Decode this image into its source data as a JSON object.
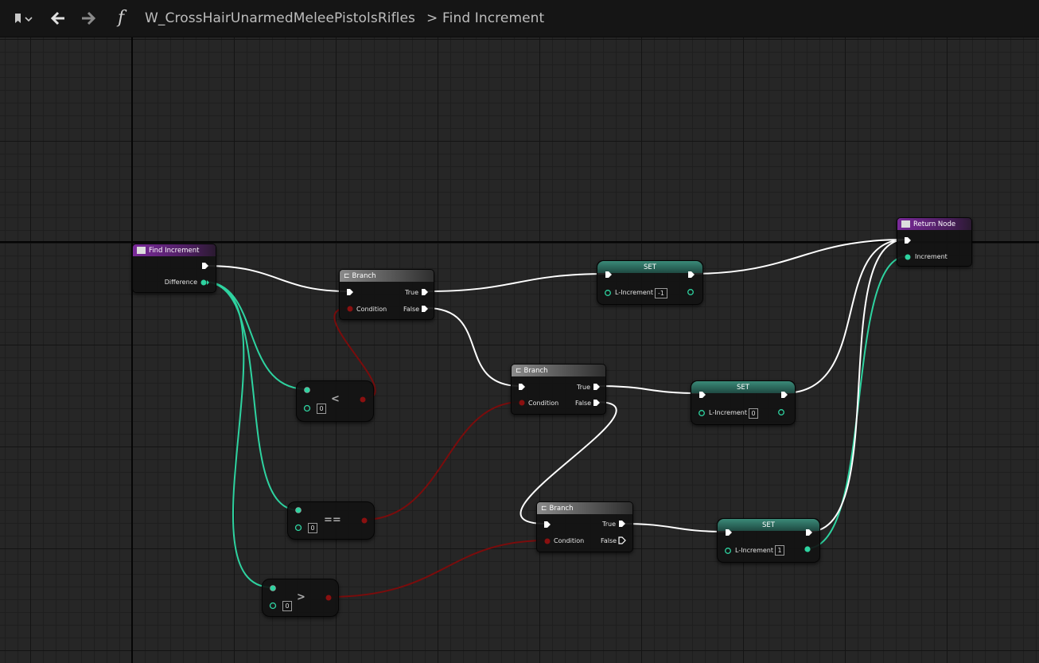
{
  "toolbar": {
    "bookmark_icon": "bookmark-icon",
    "back_icon": "arrow-left-icon",
    "forward_icon": "arrow-right-icon",
    "function_glyph": "f",
    "breadcrumb_root": "W_CrossHairUnarmedMeleePistolsRifles",
    "breadcrumb_separator": ">",
    "breadcrumb_current": "Find Increment"
  },
  "nodes": {
    "entry": {
      "title": "Find Increment",
      "pin_difference": "Difference"
    },
    "branch1": {
      "title": "Branch",
      "pin_condition": "Condition",
      "pin_true": "True",
      "pin_false": "False"
    },
    "branch2": {
      "title": "Branch",
      "pin_condition": "Condition",
      "pin_true": "True",
      "pin_false": "False"
    },
    "branch3": {
      "title": "Branch",
      "pin_condition": "Condition",
      "pin_true": "True",
      "pin_false": "False"
    },
    "less": {
      "operator": "<",
      "value": "0"
    },
    "equal": {
      "operator": "==",
      "value": "0"
    },
    "greater": {
      "operator": ">",
      "value": "0"
    },
    "set1": {
      "title": "SET",
      "var": "L-Increment",
      "value": "-1"
    },
    "set2": {
      "title": "SET",
      "var": "L-Increment",
      "value": "0"
    },
    "set3": {
      "title": "SET",
      "var": "L-Increment",
      "value": "1"
    },
    "ret": {
      "title": "Return Node",
      "pin_increment": "Increment"
    }
  },
  "colors": {
    "exec_wire": "#ffffff",
    "float_wire": "#2ed3a0",
    "bool_wire": "#7a0c0c",
    "function_header": "#6b2a88",
    "set_header": "#2f6e62"
  }
}
